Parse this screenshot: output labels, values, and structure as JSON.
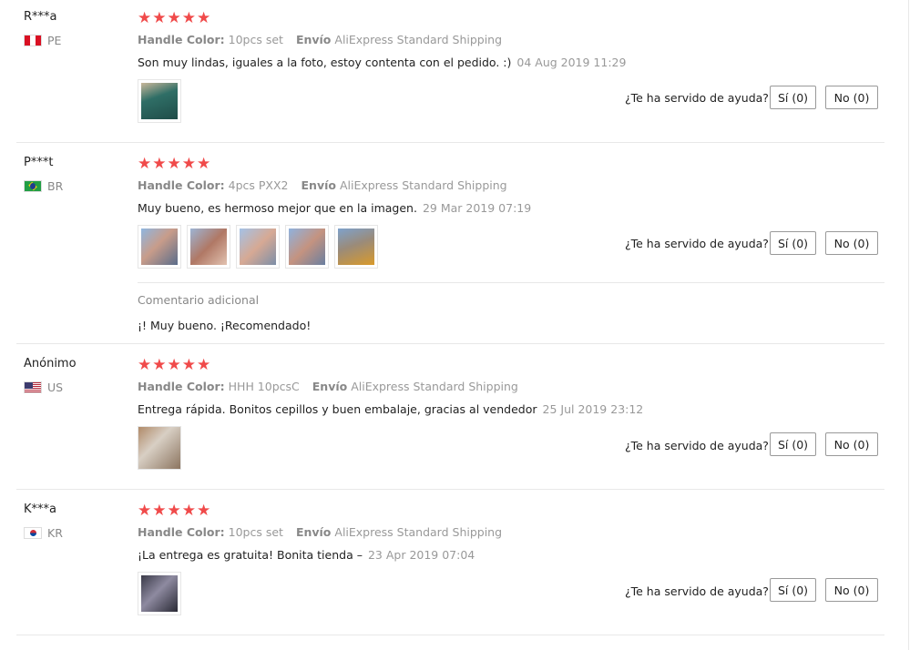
{
  "helpful_label": "¿Te ha servido de ayuda?",
  "stars": "★★★★★",
  "attr_handle_label": "Handle Color:",
  "attr_ship_label": "Envío",
  "reviews": [
    {
      "user": "R***a",
      "country": "PE",
      "handle": "10pcs set",
      "shipping": "AliExpress Standard Shipping",
      "text": "Son muy lindas, iguales a la foto, estoy contenta con el pedido. :)",
      "date": "04 Aug 2019 11:29",
      "yes": "Sí (0)",
      "no": "No (0)"
    },
    {
      "user": "P***t",
      "country": "BR",
      "handle": "4pcs PXX2",
      "shipping": "AliExpress Standard Shipping",
      "text": "Muy bueno, es hermoso mejor que en la imagen.",
      "date": "29 Mar 2019 07:19",
      "yes": "Sí (0)",
      "no": "No (0)",
      "additional_title": "Comentario adicional",
      "additional_text": "¡! Muy bueno. ¡Recomendado!"
    },
    {
      "user": "Anónimo",
      "country": "US",
      "handle": "HHH 10pcsC",
      "shipping": "AliExpress Standard Shipping",
      "text": "Entrega rápida. Bonitos cepillos y buen embalaje, gracias al vendedor",
      "date": "25 Jul 2019 23:12",
      "yes": "Sí (0)",
      "no": "No (0)"
    },
    {
      "user": "K***a",
      "country": "KR",
      "handle": "10pcs set",
      "shipping": "AliExpress Standard Shipping",
      "text": "¡La entrega es gratuita! Bonita tienda –",
      "date": "23 Apr 2019 07:04",
      "yes": "Sí (0)",
      "no": "No (0)"
    }
  ],
  "colors": {
    "star": "#f04a4a",
    "muted": "#999999",
    "divider": "#e8e8e8"
  }
}
